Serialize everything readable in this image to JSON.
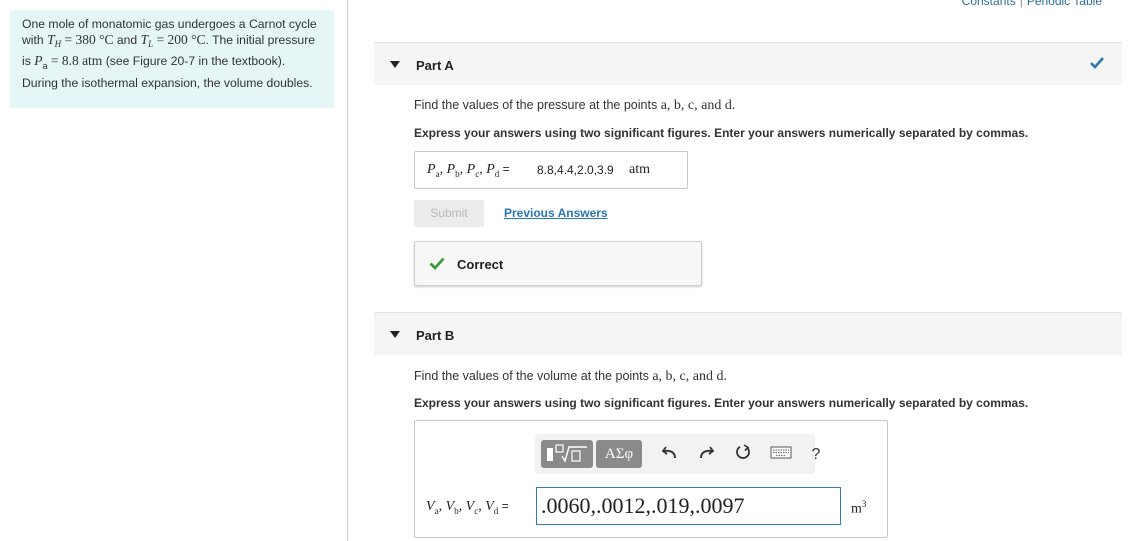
{
  "top_links": {
    "constants": "Constants",
    "separator": "|",
    "periodic_table": "Periodic Table"
  },
  "problem": {
    "t1": "One mole of monatomic gas undergoes a Carnot cycle with ",
    "th_sym": "T",
    "th_sub": "H",
    "th_val": " = 380 °C",
    "and1": " and ",
    "tl_sym": "T",
    "tl_sub": "L",
    "tl_val": " = 200 °C",
    "t2": ". The initial pressure is ",
    "pa_sym": "P",
    "pa_sub": "a",
    "pa_val": " = 8.8 atm",
    "t3": " (see Figure 20-7 in the textbook). During the isothermal expansion, the volume doubles."
  },
  "part_a": {
    "title": "Part A",
    "instruction_pre": "Find the values of the pressure at the points ",
    "points": "a, b, c, and d.",
    "express": "Express your answers using two significant figures. Enter your answers numerically separated by commas.",
    "answer_label_var": "P",
    "subs": [
      "a",
      "b",
      "c",
      "d"
    ],
    "answer_eq": " =",
    "answer_value": "8.8,4.4,2.0,3.9",
    "answer_unit": "atm",
    "submit_label": "Submit",
    "previous_answers_label": "Previous Answers",
    "feedback": "Correct",
    "accent_color": "#2c7ab0",
    "correct_color": "#3a9b3a"
  },
  "part_b": {
    "title": "Part B",
    "instruction_pre": "Find the values of the volume at the points ",
    "points": "a, b, c, and d.",
    "express": "Express your answers using two significant figures. Enter your answers numerically separated by commas.",
    "answer_label_var": "V",
    "subs": [
      "a",
      "b",
      "c",
      "d"
    ],
    "answer_eq": " =",
    "answer_value": ".0060,.0012,.019,.0097",
    "answer_unit": "m",
    "answer_unit_sup": "3",
    "toolbar": {
      "greek_label": "ΑΣφ",
      "help_label": "?",
      "icons": [
        "templates-icon",
        "greek-symbols-icon",
        "undo-icon",
        "redo-icon",
        "reset-icon",
        "keyboard-icon",
        "help-icon"
      ]
    }
  }
}
